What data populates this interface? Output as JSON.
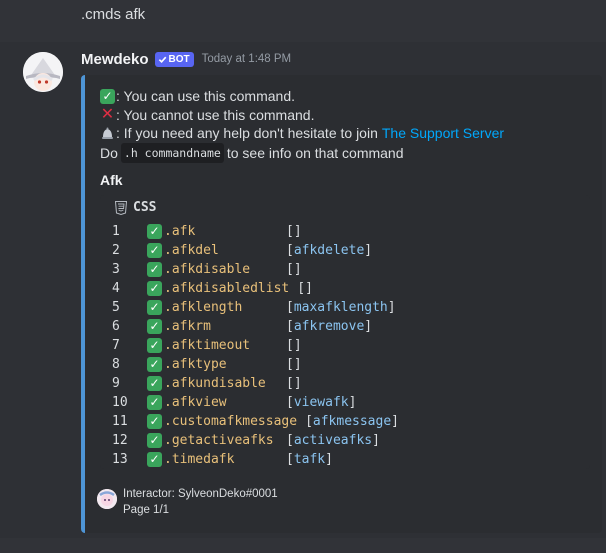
{
  "previous_message": {
    "text": ".cmds afk"
  },
  "message": {
    "author": "Mewdeko",
    "bot_tag": "BOT",
    "timestamp": "Today at 1:48 PM"
  },
  "embed": {
    "accent_color": "#4e95d6",
    "description": {
      "line1": ": You can use this command.",
      "line2": ": You cannot use this command.",
      "line3": ": If you need any help don't hesitate to join",
      "support_link": "The Support Server",
      "line4_prefix": "Do",
      "inline_code": ".h commandname",
      "line4_suffix": "to see info on that command"
    },
    "field_name": "Afk",
    "code_language": "CSS",
    "commands": [
      {
        "n": "1",
        "name": ".afk",
        "alias": ""
      },
      {
        "n": "2",
        "name": ".afkdel",
        "alias": "afkdelete"
      },
      {
        "n": "3",
        "name": ".afkdisable",
        "alias": ""
      },
      {
        "n": "4",
        "name": ".afkdisabledlist",
        "alias": ""
      },
      {
        "n": "5",
        "name": ".afklength",
        "alias": "maxafklength"
      },
      {
        "n": "6",
        "name": ".afkrm",
        "alias": "afkremove"
      },
      {
        "n": "7",
        "name": ".afktimeout",
        "alias": ""
      },
      {
        "n": "8",
        "name": ".afktype",
        "alias": ""
      },
      {
        "n": "9",
        "name": ".afkundisable",
        "alias": ""
      },
      {
        "n": "10",
        "name": ".afkview",
        "alias": "viewafk"
      },
      {
        "n": "11",
        "name": ".customafkmessage",
        "alias": "afkmessage"
      },
      {
        "n": "12",
        "name": ".getactiveafks",
        "alias": "activeafks"
      },
      {
        "n": "13",
        "name": ".timedafk",
        "alias": "tafk"
      }
    ],
    "footer": {
      "interactor": "Interactor: SylveonDeko#0001",
      "page": "Page 1/1"
    }
  }
}
